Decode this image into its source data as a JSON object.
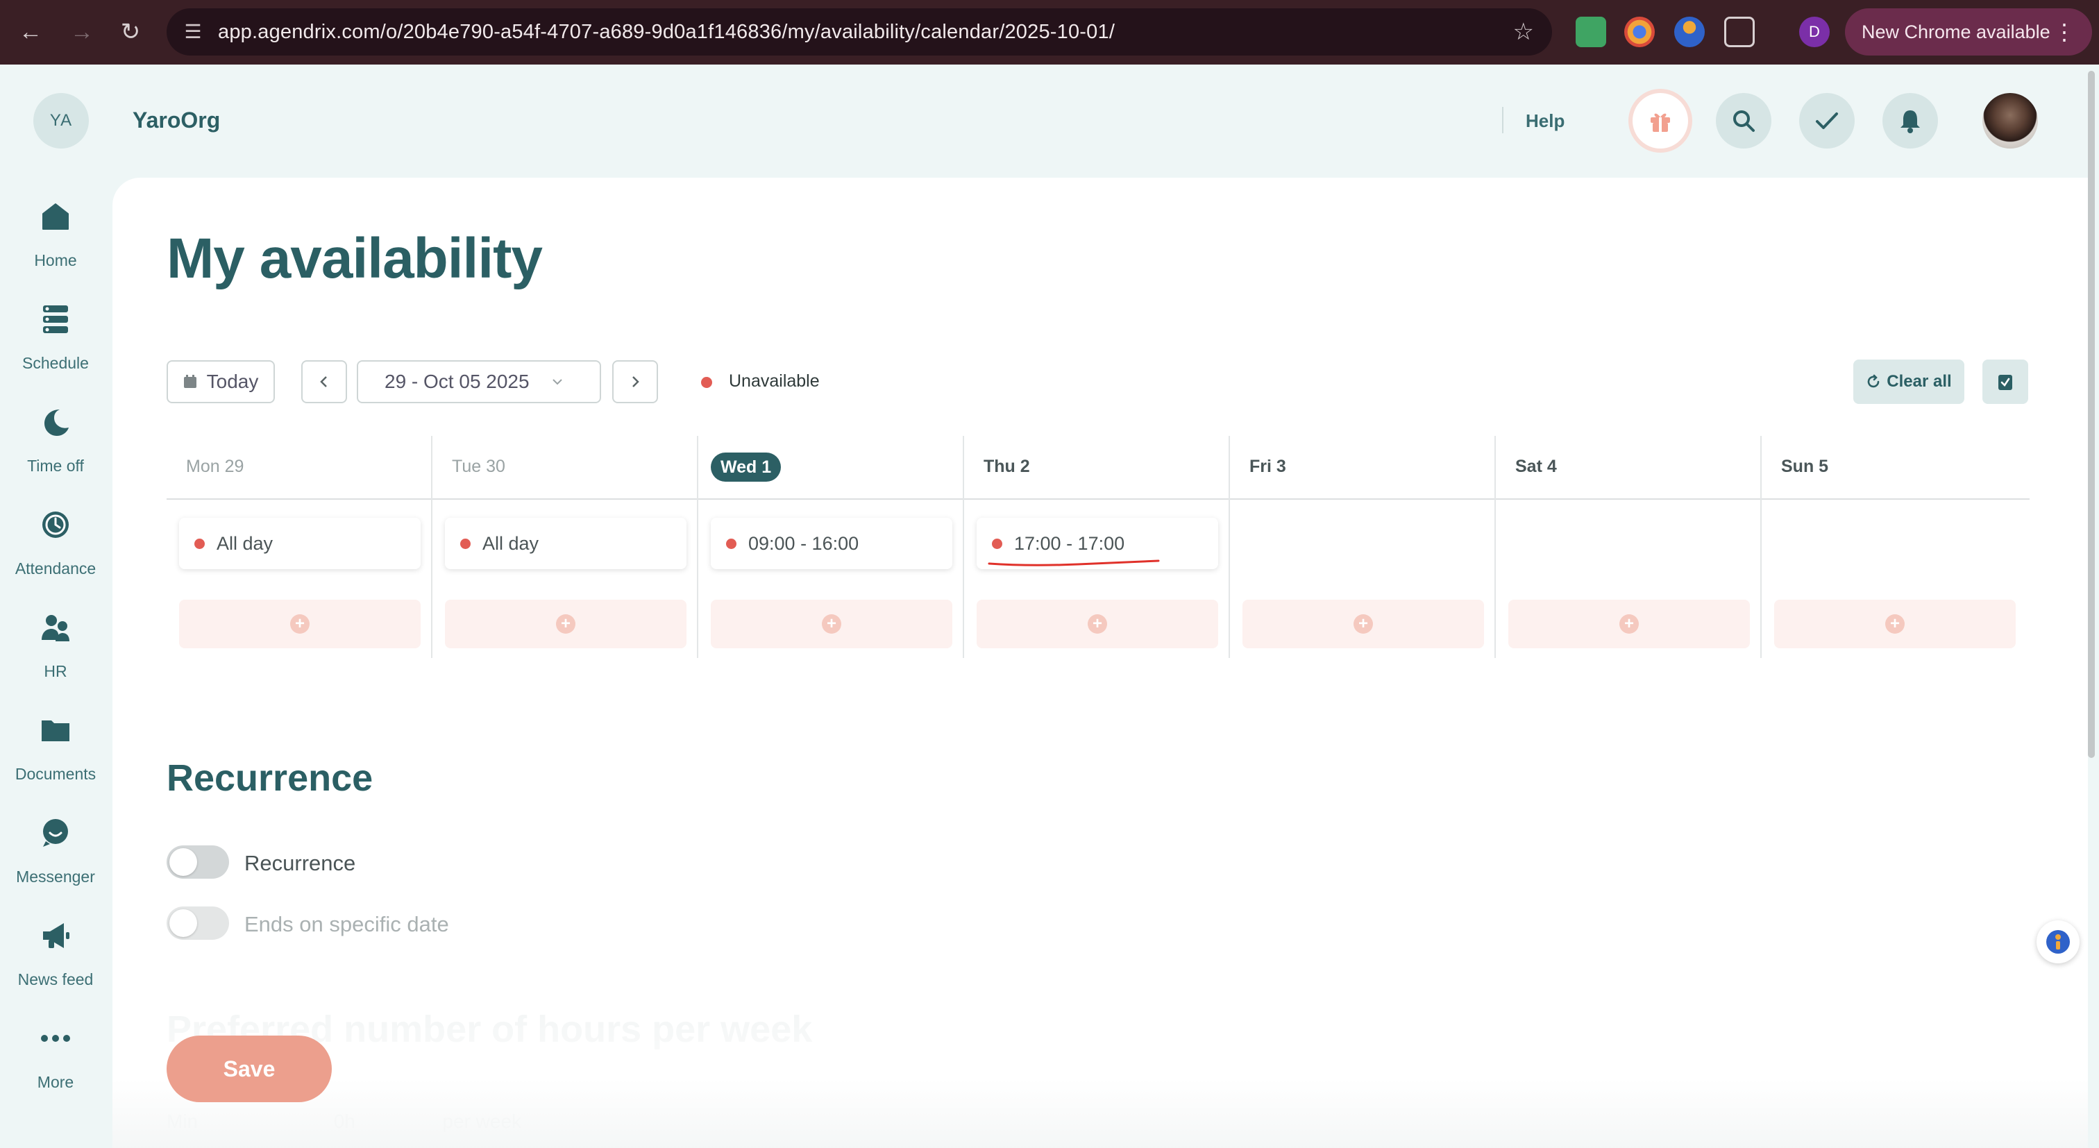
{
  "browser": {
    "url": "app.agendrix.com/o/20b4e790-a54f-4707-a689-9d0a1f146836/my/availability/calendar/2025-10-01/",
    "profile_initial": "D",
    "update_label": "New Chrome available"
  },
  "topbar": {
    "org_initials": "YA",
    "org_name": "YaroOrg",
    "help_label": "Help"
  },
  "sidebar": {
    "items": [
      {
        "label": "Home",
        "icon": "home-icon"
      },
      {
        "label": "Schedule",
        "icon": "schedule-icon"
      },
      {
        "label": "Time off",
        "icon": "moon-icon"
      },
      {
        "label": "Attendance",
        "icon": "clock-icon"
      },
      {
        "label": "HR",
        "icon": "people-icon"
      },
      {
        "label": "Documents",
        "icon": "folder-icon"
      },
      {
        "label": "Messenger",
        "icon": "chat-icon"
      },
      {
        "label": "News feed",
        "icon": "megaphone-icon"
      },
      {
        "label": "More",
        "icon": "more-icon"
      }
    ]
  },
  "main": {
    "title": "My availability",
    "toolbar": {
      "today_label": "Today",
      "date_range": "29 - Oct 05 2025",
      "legend_label": "Unavailable",
      "clear_all_label": "Clear all"
    },
    "calendar": {
      "days": [
        {
          "label": "Mon 29",
          "slot": "All day"
        },
        {
          "label": "Tue 30",
          "slot": "All day"
        },
        {
          "label": "Wed 1",
          "slot": "09:00 - 16:00",
          "today": true
        },
        {
          "label": "Thu 2",
          "slot": "17:00 - 17:00"
        },
        {
          "label": "Fri 3",
          "slot": null
        },
        {
          "label": "Sat 4",
          "slot": null
        },
        {
          "label": "Sun 5",
          "slot": null
        }
      ]
    },
    "recurrence": {
      "heading": "Recurrence",
      "toggle1_label": "Recurrence",
      "toggle2_label": "Ends on specific date"
    },
    "preferred": {
      "heading": "Preferred number of hours per week",
      "min_label": "Min",
      "value": "0h",
      "unit": "per week"
    },
    "save_label": "Save"
  },
  "colors": {
    "brand": "#2c5f64",
    "unavailable": "#e25c54",
    "save": "#ec9f8d",
    "annotation": "#e0312a"
  }
}
